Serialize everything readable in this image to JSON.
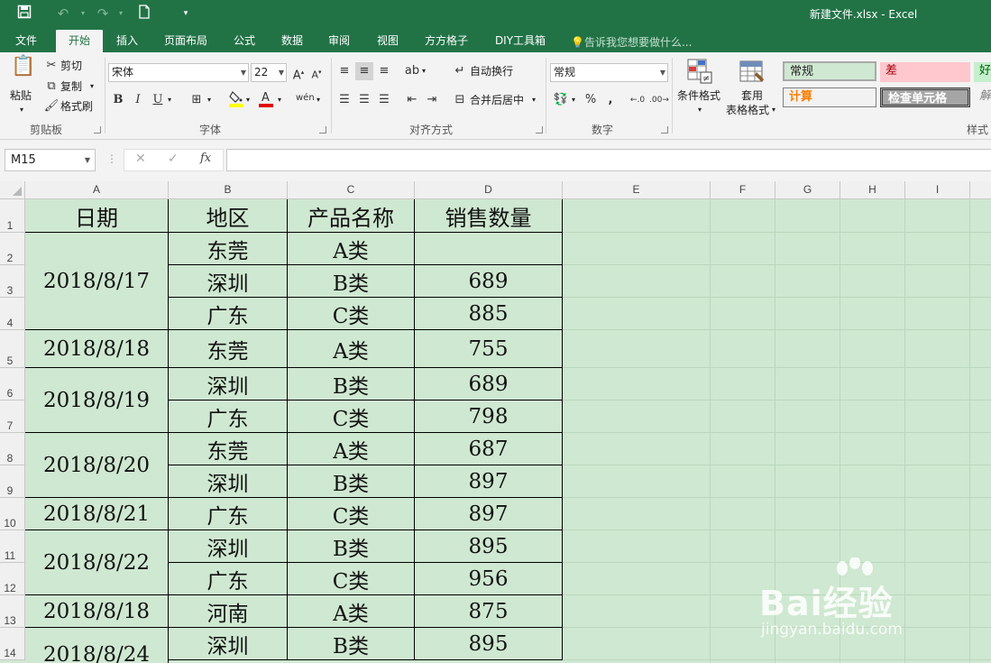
{
  "window": {
    "title": "新建文件.xlsx - Excel"
  },
  "tabs": [
    "文件",
    "开始",
    "插入",
    "页面布局",
    "公式",
    "数据",
    "审阅",
    "视图",
    "方方格子",
    "DIY工具箱"
  ],
  "active_tab": "开始",
  "tell_me": "告诉我您想要做什么...",
  "ribbon": {
    "clipboard": {
      "paste": "粘贴",
      "cut": "剪切",
      "copy": "复制",
      "format_painter": "格式刷",
      "label": "剪贴板"
    },
    "font": {
      "name": "宋体",
      "size": "22",
      "label": "字体",
      "bold": "B",
      "italic": "I",
      "underline": "U"
    },
    "alignment": {
      "wrap": "自动换行",
      "merge": "合并后居中",
      "label": "对齐方式"
    },
    "number": {
      "format": "常规",
      "label": "数字",
      "percent": "%",
      "comma": ","
    },
    "styles": {
      "conditional": "条件格式",
      "table_line1": "套用",
      "table_line2": "表格格式",
      "normal": "常规",
      "bad": "差",
      "good": "好",
      "calc": "计算",
      "check": "检查单元格",
      "explain": "解",
      "label": "样式"
    }
  },
  "formula_bar": {
    "name_box": "M15",
    "fx": "fx",
    "content": ""
  },
  "columns": [
    "A",
    "B",
    "C",
    "D",
    "E",
    "F",
    "G",
    "H",
    "I"
  ],
  "rows": [
    "1",
    "2",
    "3",
    "4",
    "5",
    "6",
    "7",
    "8",
    "9",
    "10",
    "11",
    "12",
    "13",
    "14"
  ],
  "table": {
    "headers": [
      "日期",
      "地区",
      "产品名称",
      "销售数量"
    ],
    "dates": [
      "2018/8/17",
      "2018/8/18",
      "2018/8/19",
      "2018/8/20",
      "2018/8/21",
      "2018/8/22",
      "2018/8/18",
      "2018/8/24"
    ],
    "regions": [
      "东莞",
      "深圳",
      "广东",
      "东莞",
      "深圳",
      "广东",
      "东莞",
      "深圳",
      "广东",
      "深圳",
      "广东",
      "河南",
      "深圳"
    ],
    "products": [
      "A类",
      "B类",
      "C类",
      "A类",
      "B类",
      "C类",
      "A类",
      "B类",
      "C类",
      "B类",
      "C类",
      "A类",
      "B类"
    ],
    "quantities": [
      "",
      "689",
      "885",
      "755",
      "689",
      "798",
      "687",
      "897",
      "897",
      "895",
      "956",
      "875",
      "895"
    ]
  },
  "watermark": {
    "brand": "Bai经验",
    "url": "jingyan.baidu.com"
  }
}
